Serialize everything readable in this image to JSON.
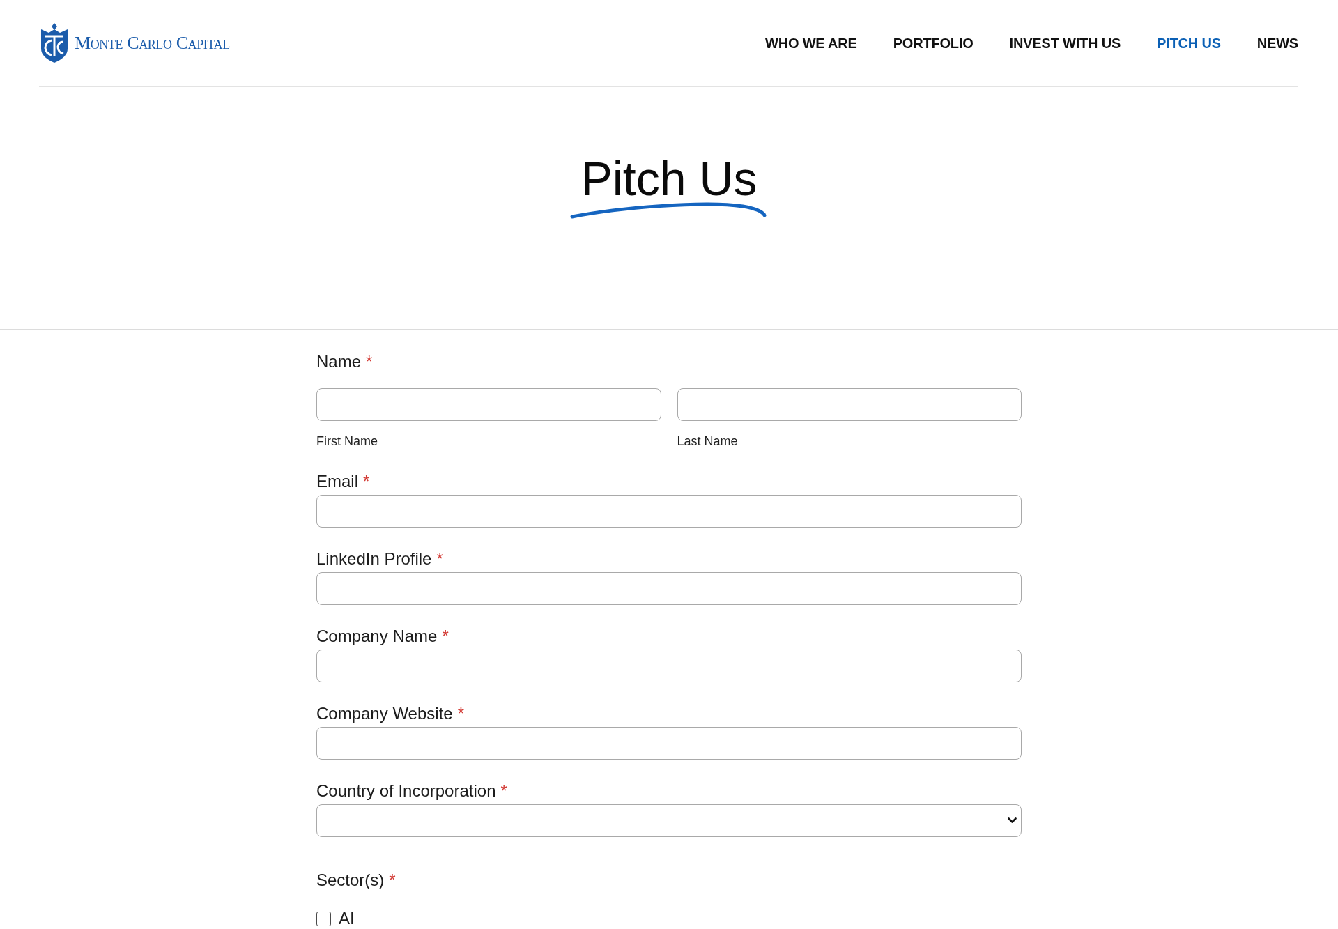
{
  "header": {
    "logo": {
      "text": "Monte Carlo Capital"
    },
    "nav": [
      {
        "label": "WHO WE ARE",
        "selected": false
      },
      {
        "label": "PORTFOLIO",
        "selected": false
      },
      {
        "label": "INVEST WITH US",
        "selected": false
      },
      {
        "label": "PITCH US",
        "selected": true
      },
      {
        "label": "NEWS",
        "selected": false
      }
    ]
  },
  "hero": {
    "title": "Pitch Us"
  },
  "form": {
    "fields": [
      {
        "kind": "name",
        "label": "Name",
        "required_mark": "*",
        "inputs": [
          {
            "caption": "First Name"
          },
          {
            "caption": "Last Name"
          }
        ]
      },
      {
        "kind": "text",
        "label": "Email",
        "required_mark": "*"
      },
      {
        "kind": "text",
        "label": "LinkedIn Profile",
        "required_mark": "*"
      },
      {
        "kind": "text",
        "label": "Company Name",
        "required_mark": "*"
      },
      {
        "kind": "text",
        "label": "Company Website",
        "required_mark": "*"
      },
      {
        "kind": "select",
        "label": "Country of Incorporation",
        "required_mark": "*"
      },
      {
        "kind": "checkboxes",
        "label": "Sector(s)",
        "required_mark": "*",
        "options": [
          {
            "label": "AI",
            "checked": false
          }
        ]
      }
    ]
  }
}
